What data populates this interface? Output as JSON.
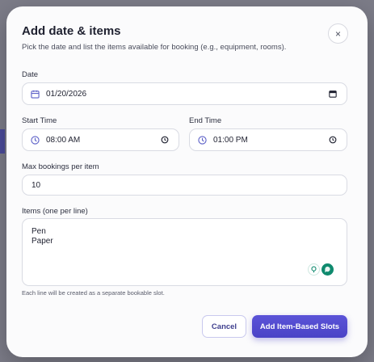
{
  "dialog": {
    "title": "Add date & items",
    "subtitle": "Pick the date and list the items available for booking (e.g., equipment, rooms).",
    "close_symbol": "×"
  },
  "date": {
    "label": "Date",
    "value": "01/20/2026"
  },
  "start_time": {
    "label": "Start Time",
    "value": "08:00 AM"
  },
  "end_time": {
    "label": "End Time",
    "value": "01:00 PM"
  },
  "max_bookings": {
    "label": "Max bookings per item",
    "value": "10"
  },
  "items": {
    "label": "Items (one per line)",
    "lines": [
      "Pen",
      "Paper"
    ],
    "helper": "Each line will be created as a separate bookable slot."
  },
  "actions": {
    "cancel_label": "Cancel",
    "submit_label": "Add Item-Based Slots"
  },
  "icons": {
    "calendar": "calendar-icon",
    "clock": "clock-icon",
    "close": "close-icon",
    "grammar_assist": "lightbulb-icon",
    "assistant": "chat-bubble-icon"
  },
  "colors": {
    "accent": "#4f49d0",
    "icon": "#5b5fc7",
    "assistant": "#0f8a6e"
  }
}
